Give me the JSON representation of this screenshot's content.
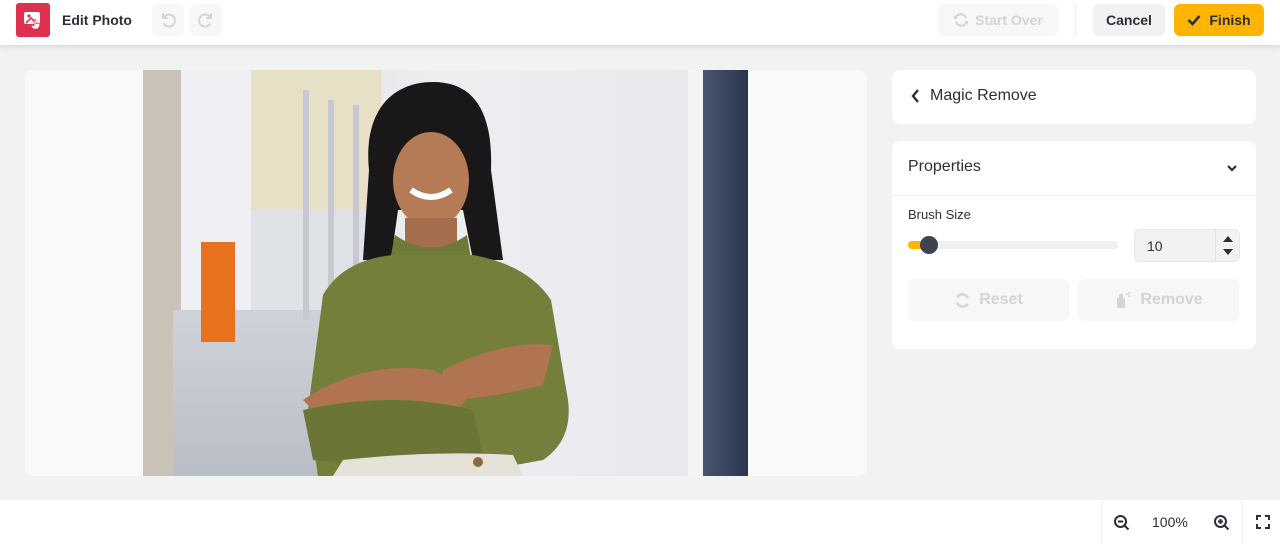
{
  "header": {
    "app_icon": "photo-edit-icon",
    "title": "Edit Photo",
    "undo_icon": "undo-icon",
    "redo_icon": "redo-icon",
    "start_over_label": "Start Over",
    "cancel_label": "Cancel",
    "finish_label": "Finish"
  },
  "canvas": {
    "image_description": "Smiling woman in olive green turtleneck with arms crossed in a bright corridor"
  },
  "tool_panel": {
    "title": "Magic Remove",
    "back_icon": "chevron-left-icon"
  },
  "properties": {
    "title": "Properties",
    "brush_size_label": "Brush Size",
    "brush_size_value": "10",
    "brush_size_fraction": 0.1,
    "reset_label": "Reset",
    "remove_label": "Remove"
  },
  "footer": {
    "zoom_value": "100%"
  },
  "colors": {
    "accent": "#ffb400",
    "brand": "#e0304f",
    "text": "#2d2e38"
  }
}
